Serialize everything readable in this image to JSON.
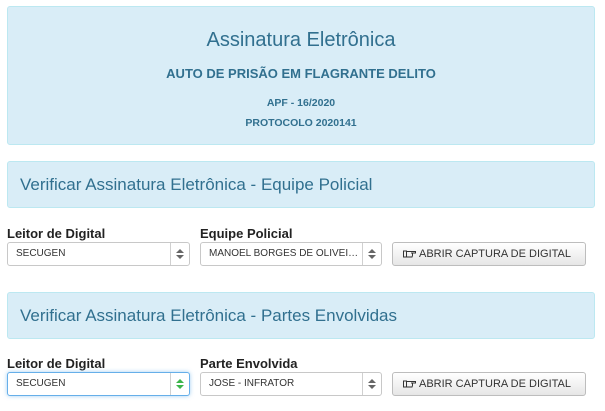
{
  "header": {
    "title": "Assinatura Eletrônica",
    "subtitle": "AUTO DE PRISÃO EM FLAGRANTE DELITO",
    "apf": "APF - 16/2020",
    "protocol": "PROTOCOLO 2020141"
  },
  "police_section": {
    "heading": "Verificar Assinatura Eletrônica - Equipe Policial",
    "reader_label": "Leitor de Digital",
    "reader_value": "SECUGEN",
    "team_label": "Equipe Policial",
    "team_value": "MANOEL BORGES DE OLIVEIRA",
    "capture_button": "ABRIR CAPTURA DE DIGITAL"
  },
  "parties_section": {
    "heading": "Verificar Assinatura Eletrônica - Partes Envolvidas",
    "reader_label": "Leitor de Digital",
    "reader_value": "SECUGEN",
    "party_label": "Parte Envolvida",
    "party_value": "JOSE - INFRATOR",
    "capture_button": "ABRIR CAPTURA DE DIGITAL"
  },
  "icons": {
    "capture": "hand-pointer-icon",
    "select_arrows": "up-down-arrows-icon"
  },
  "colors": {
    "panel_bg": "#d9edf7",
    "panel_text": "#31708f",
    "focus_accent": "#3cb54a"
  }
}
